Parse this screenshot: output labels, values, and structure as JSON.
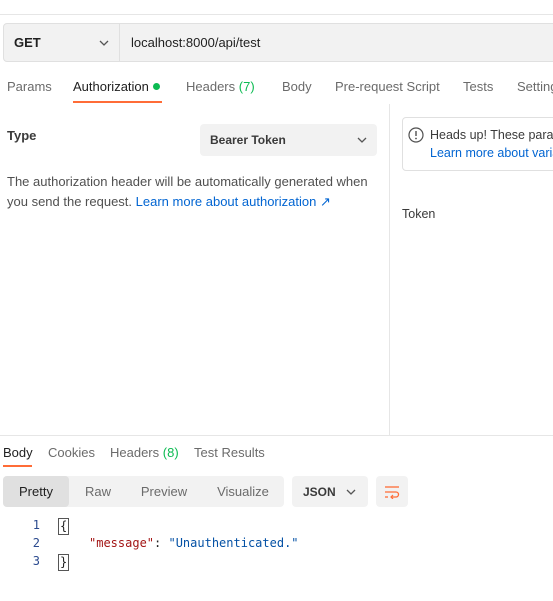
{
  "request": {
    "method": "GET",
    "url": "localhost:8000/api/test"
  },
  "request_tabs": [
    {
      "label": "Params"
    },
    {
      "label": "Authorization"
    },
    {
      "label": "Headers",
      "count": "(7)"
    },
    {
      "label": "Body"
    },
    {
      "label": "Pre-request Script"
    },
    {
      "label": "Tests"
    },
    {
      "label": "Settings"
    }
  ],
  "auth": {
    "type_label": "Type",
    "type_value": "Bearer Token",
    "description": "The authorization header will be automatically generated when you send the request. ",
    "learn_more": "Learn more about authorization ↗"
  },
  "notice": {
    "title": "Heads up! These parameters hold sensitive data.",
    "link": "Learn more about variables"
  },
  "token_label": "Token",
  "response_tabs": [
    {
      "label": "Body"
    },
    {
      "label": "Cookies"
    },
    {
      "label": "Headers",
      "count": "(8)"
    },
    {
      "label": "Test Results"
    }
  ],
  "view_modes": [
    "Pretty",
    "Raw",
    "Preview",
    "Visualize"
  ],
  "format": "JSON",
  "code": {
    "line_numbers": [
      "1",
      "2",
      "3"
    ],
    "open": "{",
    "key": "\"message\"",
    "colon": ": ",
    "value": "\"Unauthenticated.\"",
    "close": "}"
  },
  "colors": {
    "accent": "#ff6c37",
    "green": "#0cbb52",
    "link": "#0265d2"
  }
}
